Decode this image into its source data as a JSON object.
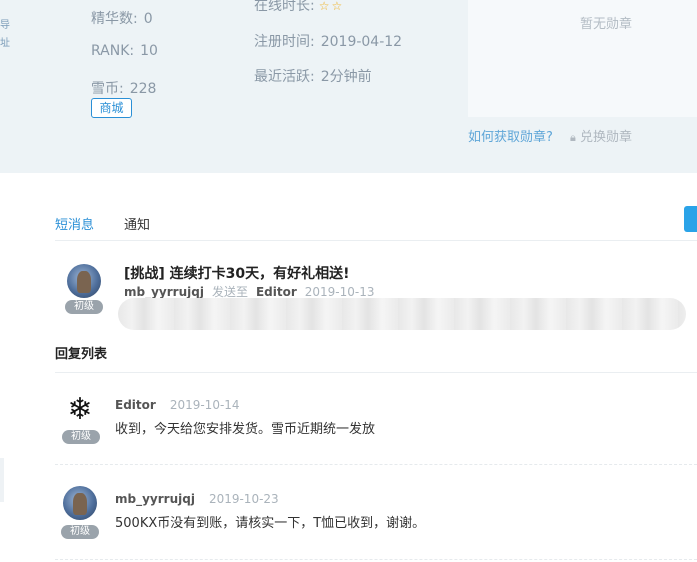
{
  "profile": {
    "left_edge_glyphs": [
      "导",
      "址"
    ],
    "essence_label": "精华数:",
    "essence_value": "0",
    "rank_label": "RANK:",
    "rank_value": "10",
    "coin_label": "雪币:",
    "coin_value": "228",
    "shop_label": "商城",
    "online_label": "在线时长:",
    "online_stars": 2,
    "register_label": "注册时间:",
    "register_value": "2019-04-12",
    "active_label": "最近活跃:",
    "active_value": "2分钟前"
  },
  "medal": {
    "empty_text": "暂无勋章",
    "how_to_link": "如何获取勋章?",
    "exchange_link": "兑换勋章",
    "lock_icon": "lock-icon"
  },
  "tabs": [
    {
      "label": "短消息",
      "active": true
    },
    {
      "label": "通知",
      "active": false
    }
  ],
  "topic": {
    "title": "[挑战] 连续打卡30天，有好礼相送!",
    "author": "mb_yyrrujqj",
    "sent_to_label": "发送至",
    "recipient": "Editor",
    "date": "2019-10-13",
    "level": "初级"
  },
  "reply_section_title": "回复列表",
  "replies": [
    {
      "author": "Editor",
      "date": "2019-10-14",
      "text": "收到，今天给您安排发货。雪币近期统一发放",
      "level": "初级",
      "avatar": "snowflake-icon"
    },
    {
      "author": "mb_yyrrujqj",
      "date": "2019-10-23",
      "text": "500KX币没有到账，请核实一下，T恤已收到，谢谢。",
      "level": "初级",
      "avatar": "wolf-avatar"
    }
  ],
  "colors": {
    "accent": "#2a8fd6",
    "band": "#edf3f6",
    "badge": "#9aa3ab"
  }
}
